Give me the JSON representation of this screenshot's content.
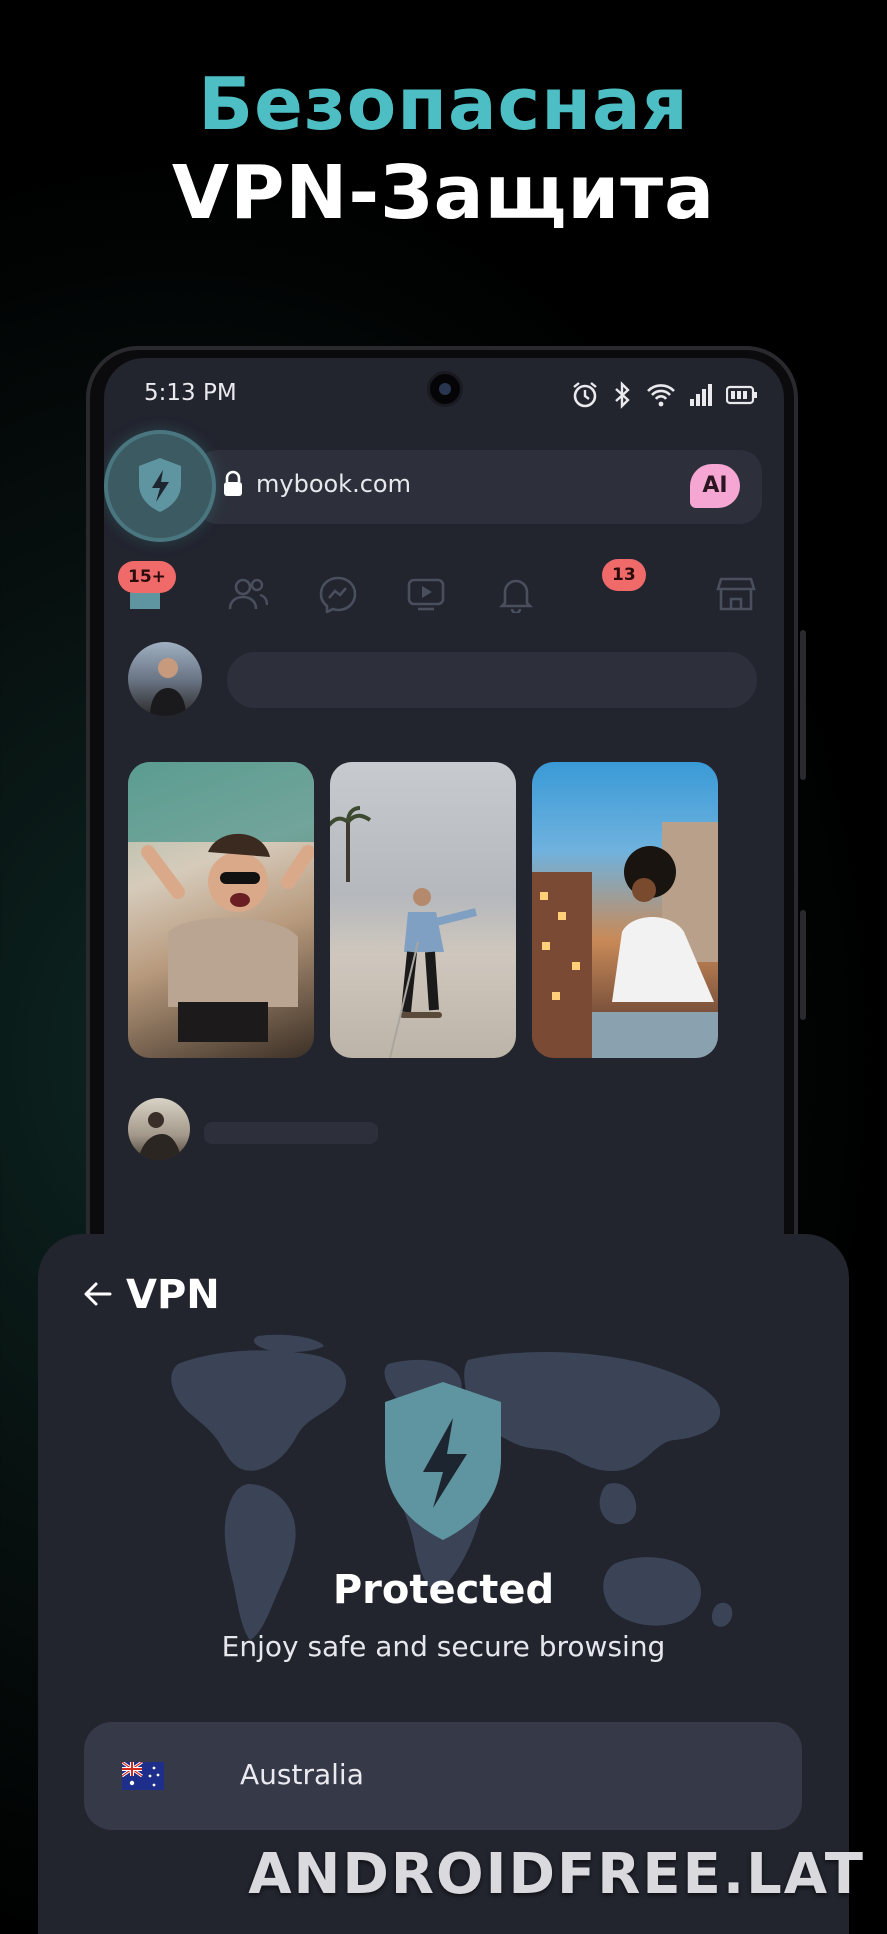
{
  "headline": {
    "line1": "Безопасная",
    "line2": "VPN-Защита"
  },
  "phone": {
    "status_bar": {
      "time": "5:13 PM",
      "icons": [
        "alarm-icon",
        "bluetooth-icon",
        "wifi-icon",
        "signal-icon",
        "battery-icon"
      ]
    },
    "browser": {
      "url": "mybook.com",
      "ai_label": "AI"
    },
    "nav": {
      "home_badge": "15+",
      "notifications_badge": "13",
      "icons": [
        "home-icon",
        "friends-icon",
        "messenger-icon",
        "video-icon",
        "bell-icon",
        "store-icon"
      ]
    }
  },
  "vpn_sheet": {
    "title": "VPN",
    "status_title": "Protected",
    "status_subtitle": "Enjoy safe and secure browsing",
    "country": "Australia"
  },
  "watermark": "ANDROIDFREE.LAT",
  "colors": {
    "accent": "#4dbfc4",
    "shield": "#5e95a1",
    "sheet_bg": "#22242e",
    "badge": "#f06a6a",
    "ai_bubble": "#f6a6d2"
  }
}
